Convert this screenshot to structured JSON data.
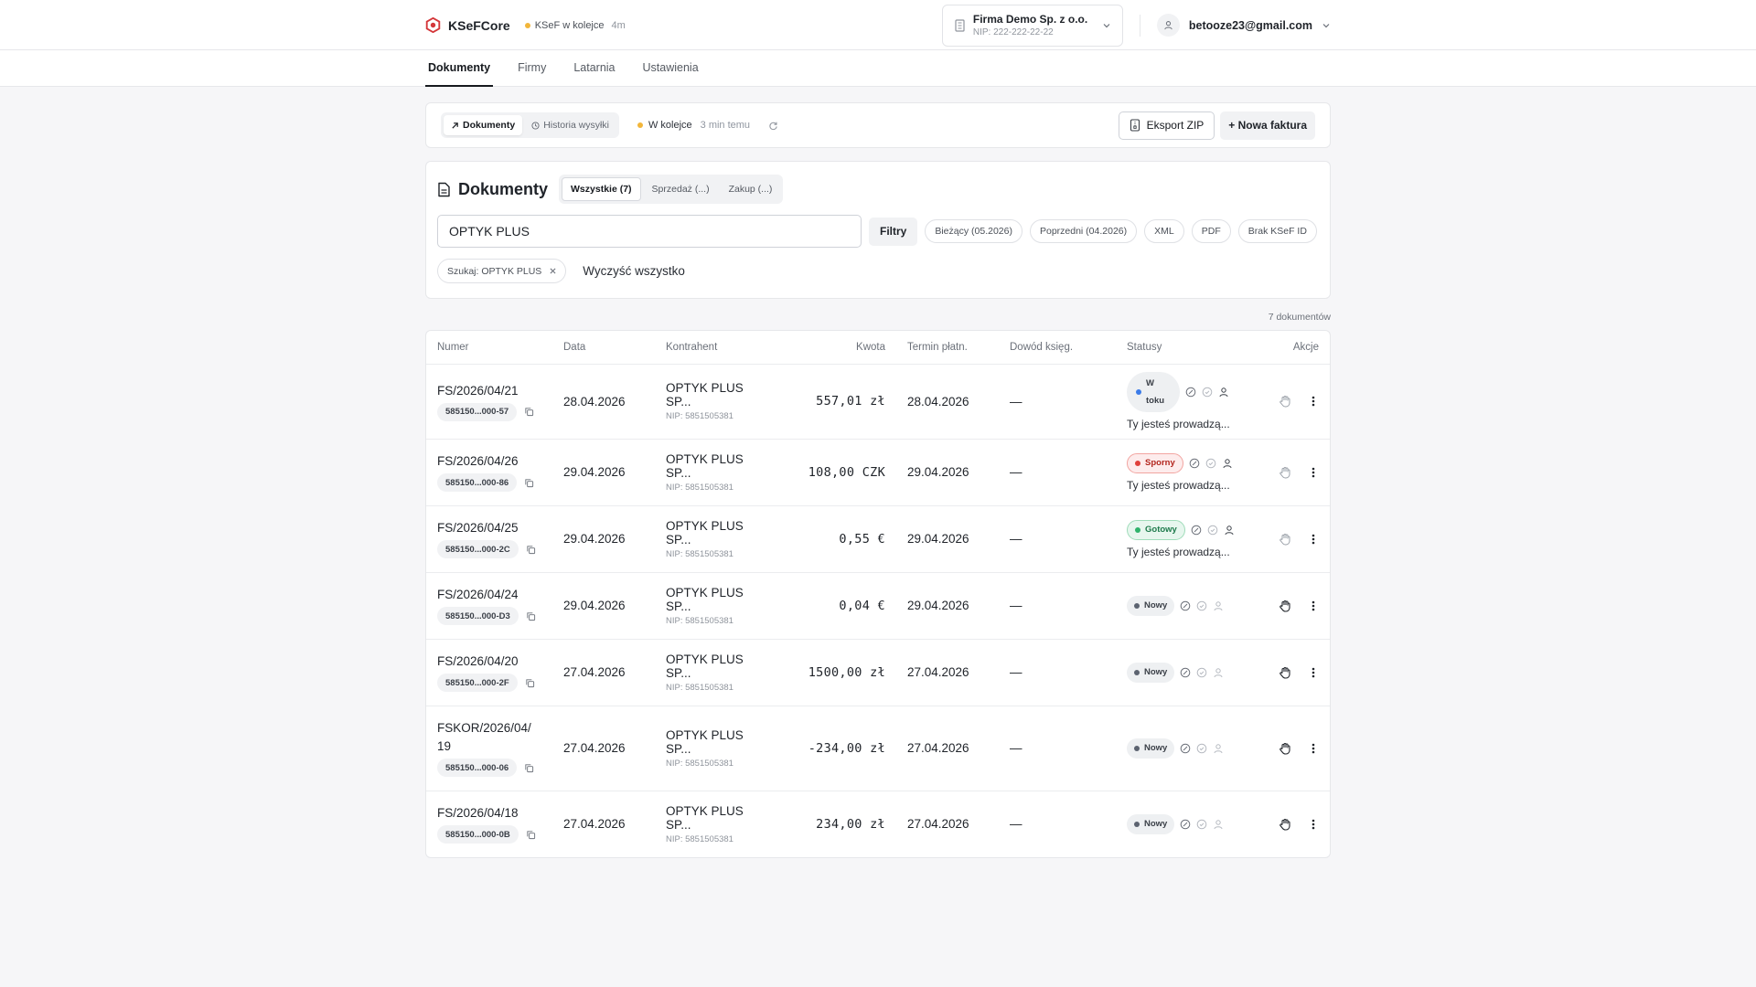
{
  "app": {
    "name": "KSeFCore"
  },
  "header": {
    "ksef_status": "KSeF w kolejce",
    "ksef_ago": "4m",
    "company": {
      "name": "Firma Demo Sp. z o.o.",
      "nip": "NIP: 222-222-22-22"
    },
    "user_email": "betooze23@gmail.com"
  },
  "nav": {
    "tabs": [
      "Dokumenty",
      "Firmy",
      "Latarnia",
      "Ustawienia"
    ]
  },
  "actionbar": {
    "seg_documents": "Dokumenty",
    "seg_history": "Historia wysyłki",
    "queue_label": "W kolejce",
    "queue_ago": "3 min temu",
    "export_label": "Eksport ZIP",
    "new_invoice_label": "+ Nowa faktura"
  },
  "documents": {
    "title": "Dokumenty",
    "filter_all": "Wszystkie (7)",
    "filter_sales": "Sprzedaż (...)",
    "filter_purchase": "Zakup (...)",
    "search_value": "OPTYK PLUS",
    "filters_btn": "Filtry",
    "chips": [
      "Bieżący (05.2026)",
      "Poprzedni (04.2026)",
      "XML",
      "PDF",
      "Brak KSeF ID"
    ],
    "active_tag": "Szukaj: OPTYK PLUS",
    "clear_all": "Wyczyść wszystko",
    "count": "7 dokumentów"
  },
  "table": {
    "headers": {
      "number": "Numer",
      "date": "Data",
      "contractor": "Kontrahent",
      "amount": "Kwota",
      "due": "Termin płatn.",
      "proof": "Dowód księg.",
      "statuses": "Statusy",
      "actions": "Akcje"
    },
    "rows": [
      {
        "number": "FS/2026/04/21",
        "ksef": "585150...000-57",
        "date": "28.04.2026",
        "contractor": "OPTYK PLUS SP...",
        "nip": "NIP: 5851505381",
        "amount": "557,01 zł",
        "due": "28.04.2026",
        "proof": "—",
        "status_line1": "W",
        "status_line2": "toku",
        "lead": "Ty jesteś prowadzą..."
      },
      {
        "number": "FS/2026/04/26",
        "ksef": "585150...000-86",
        "date": "29.04.2026",
        "contractor": "OPTYK PLUS SP...",
        "nip": "NIP: 5851505381",
        "amount": "108,00 CZK",
        "due": "29.04.2026",
        "proof": "—",
        "status": "Sporny",
        "lead": "Ty jesteś prowadzą..."
      },
      {
        "number": "FS/2026/04/25",
        "ksef": "585150...000-2C",
        "date": "29.04.2026",
        "contractor": "OPTYK PLUS SP...",
        "nip": "NIP: 5851505381",
        "amount": "0,55 €",
        "due": "29.04.2026",
        "proof": "—",
        "status": "Gotowy",
        "lead": "Ty jesteś prowadzą..."
      },
      {
        "number": "FS/2026/04/24",
        "ksef": "585150...000-D3",
        "date": "29.04.2026",
        "contractor": "OPTYK PLUS SP...",
        "nip": "NIP: 5851505381",
        "amount": "0,04 €",
        "due": "29.04.2026",
        "proof": "—",
        "status": "Nowy"
      },
      {
        "number": "FS/2026/04/20",
        "ksef": "585150...000-2F",
        "date": "27.04.2026",
        "contractor": "OPTYK PLUS SP...",
        "nip": "NIP: 5851505381",
        "amount": "1500,00 zł",
        "due": "27.04.2026",
        "proof": "—",
        "status": "Nowy"
      },
      {
        "number_line1": "FSKOR/2026/04/",
        "number_line2": "19",
        "ksef": "585150...000-06",
        "date": "27.04.2026",
        "contractor": "OPTYK PLUS SP...",
        "nip": "NIP: 5851505381",
        "amount": "-234,00 zł",
        "due": "27.04.2026",
        "proof": "—",
        "status": "Nowy"
      },
      {
        "number": "FS/2026/04/18",
        "ksef": "585150...000-0B",
        "date": "27.04.2026",
        "contractor": "OPTYK PLUS SP...",
        "nip": "NIP: 5851505381",
        "amount": "234,00 zł",
        "due": "27.04.2026",
        "proof": "—",
        "status": "Nowy"
      }
    ]
  },
  "colors": {
    "brand": "#d4373a",
    "queue": "#f2b63a",
    "in_progress": "#3b7be8",
    "ready": "#2fb36b",
    "disputed": "#e0403b",
    "new": "#5c6370"
  },
  "icons": [
    "logo-icon",
    "building-icon",
    "chevron-down-icon",
    "user-icon",
    "arrow-up-right-icon",
    "clock-icon",
    "refresh-icon",
    "zip-file-icon",
    "document-icon",
    "close-icon",
    "copy-icon",
    "compass-icon",
    "check-circle-icon",
    "person-icon",
    "hand-icon",
    "more-vertical-icon"
  ]
}
